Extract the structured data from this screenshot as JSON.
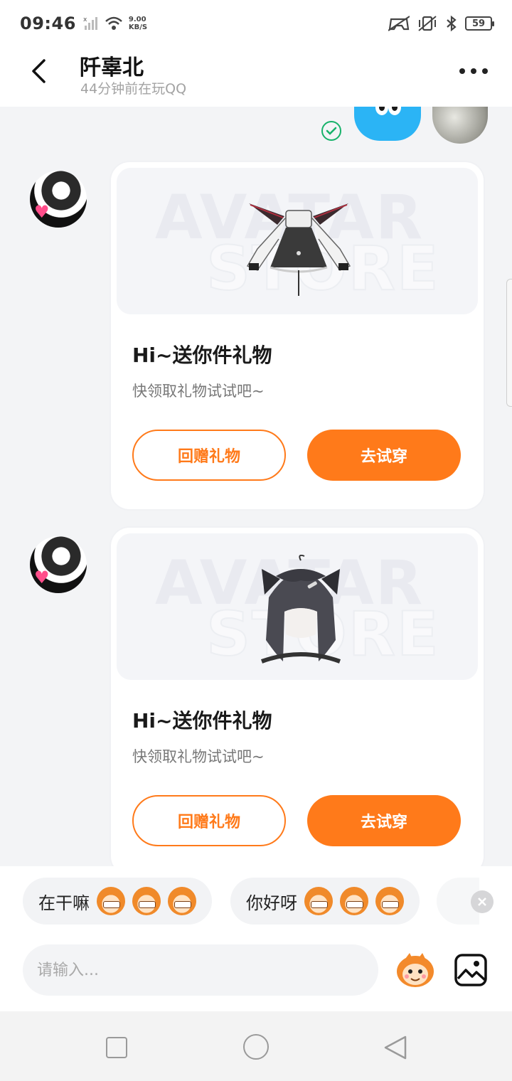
{
  "status_bar": {
    "time": "09:46",
    "net_speed_value": "9.00",
    "net_speed_unit": "KB/S",
    "battery": "59"
  },
  "header": {
    "contact_name": "阡辜北",
    "contact_status": "44分钟前在玩QQ"
  },
  "messages": [
    {
      "title": "Hi~送你件礼物",
      "subtitle": "快领取礼物试试吧~",
      "watermark_line1": "AVATAR",
      "watermark_line2": "STORE",
      "return_label": "回赠礼物",
      "try_label": "去试穿",
      "item": "dress"
    },
    {
      "title": "Hi~送你件礼物",
      "subtitle": "快领取礼物试试吧~",
      "watermark_line1": "AVATAR",
      "watermark_line2": "STORE",
      "return_label": "回赠礼物",
      "try_label": "去试穿",
      "item": "wig"
    }
  ],
  "quick_replies": [
    {
      "label": "在干嘛",
      "emoji": "grinning-face-icon"
    },
    {
      "label": "你好呀",
      "emoji": "smiling-face-icon"
    }
  ],
  "input": {
    "placeholder": "请输入..."
  },
  "colors": {
    "accent": "#ff7a1a",
    "read_check": "#17b26a",
    "sticker_blue": "#2bb4f5"
  }
}
